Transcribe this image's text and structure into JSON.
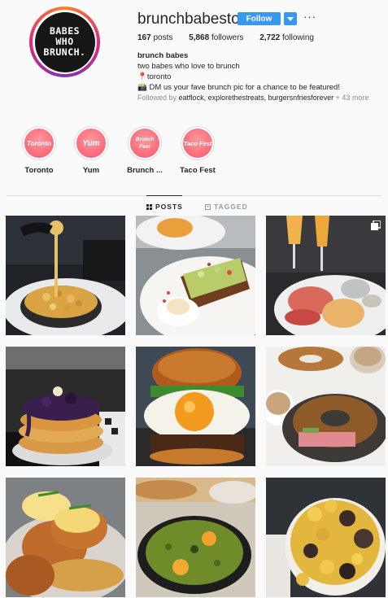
{
  "profile": {
    "username": "brunchbabesto",
    "avatar_text": [
      "BABES",
      "WHO",
      "BRUNCH."
    ],
    "follow_label": "Follow",
    "more_label": "···",
    "stats": {
      "posts_count": "167",
      "posts_label": "posts",
      "followers_count": "5,868",
      "followers_label": "followers",
      "following_count": "2,722",
      "following_label": "following"
    },
    "bio": {
      "name": "brunch babes",
      "line1": "two babes who love to brunch",
      "line2_icon": "📍",
      "line2": "toronto",
      "line3_icon": "📸",
      "line3": "DM us your fave brunch pic for a chance to be featured!"
    },
    "followed_by": {
      "prefix": "Followed by",
      "names": "eatflock, explorethestreats, burgersnfriesforever",
      "suffix": "+ 43 more"
    }
  },
  "highlights": [
    {
      "cover_text": "Toronto",
      "label": "Toronto"
    },
    {
      "cover_text": "Yum",
      "label": "Yum"
    },
    {
      "cover_text": "Brunch Fest",
      "label": "Brunch ..."
    },
    {
      "cover_text": "Taco Fest",
      "label": "Taco Fest"
    }
  ],
  "tabs": {
    "posts": "POSTS",
    "tagged": "TAGGED"
  },
  "icons": {
    "dropdown": "chevron-down-icon",
    "posts_tab": "grid-icon",
    "tagged_tab": "tag-icon",
    "multi_post": "multiple-images-icon"
  },
  "colors": {
    "accent": "#3897f0",
    "highlight": "#f6546a",
    "text": "#262626",
    "muted": "#8e8e8e"
  }
}
